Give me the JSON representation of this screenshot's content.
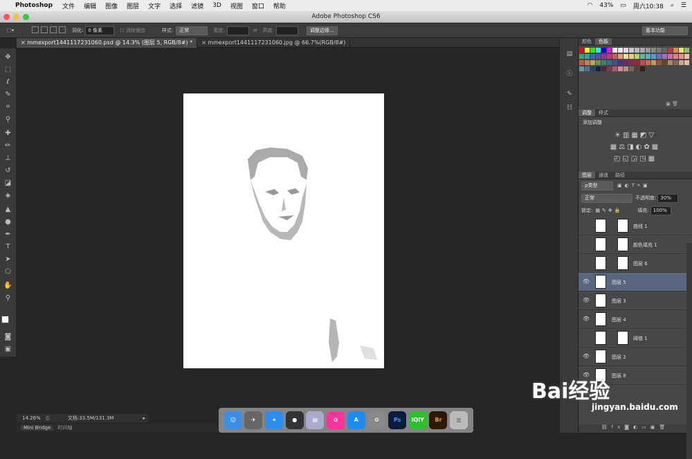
{
  "menubar": {
    "app": "Photoshop",
    "items": [
      "文件",
      "编辑",
      "图像",
      "图层",
      "文字",
      "选择",
      "滤镜",
      "3D",
      "视图",
      "窗口",
      "帮助"
    ],
    "battery": "43%",
    "clock": "周六10:38"
  },
  "window": {
    "title": "Adobe Photoshop CS6"
  },
  "options": {
    "feather_label": "羽化:",
    "feather_value": "0 像素",
    "antialias": "消除锯齿",
    "style_label": "样式:",
    "style_value": "正常",
    "width_label": "宽度:",
    "height_label": "高度:",
    "refine_button": "调整边缘...",
    "workspace": "基本功能"
  },
  "tabs": [
    {
      "label": "mmexport1441117231060.psd @ 14.3% (图层 5, RGB/8#) *"
    },
    {
      "label": "mmexport1441117231060.jpg @ 66.7%(RGB/8#)"
    }
  ],
  "status": {
    "zoom": "14.26%",
    "doc": "文档:33.5M/131.3M"
  },
  "minibridge": {
    "tab1": "Mini Bridge",
    "tab2": "时间轴"
  },
  "dock": [
    "Ps",
    "iQIY",
    "Br"
  ],
  "panels": {
    "color": {
      "tab1": "颜色",
      "tab2": "色板"
    },
    "adjust": {
      "tab1": "调整",
      "tab2": "样式",
      "heading": "添加调整"
    },
    "layers": {
      "tab1": "图层",
      "tab2": "通道",
      "tab3": "路径",
      "kind": "ρ类型",
      "blend": "正常",
      "opacity_label": "不透明度:",
      "opacity_value": "30%",
      "lock_label": "锁定:",
      "fill_label": "填充:",
      "fill_value": "100%",
      "rows": [
        {
          "name": "曲线 1",
          "mask": true
        },
        {
          "name": "颜色填充 1",
          "mask": true
        },
        {
          "name": "图层 6",
          "mask": true
        },
        {
          "name": "图层 5",
          "selected": true
        },
        {
          "name": "图层 3"
        },
        {
          "name": "图层 4"
        },
        {
          "name": "阈值 1",
          "mask": true
        },
        {
          "name": "图层 2"
        },
        {
          "name": "图层 8"
        }
      ]
    }
  },
  "watermark": {
    "brand": "Bai经验",
    "url": "jingyan.baidu.com"
  }
}
